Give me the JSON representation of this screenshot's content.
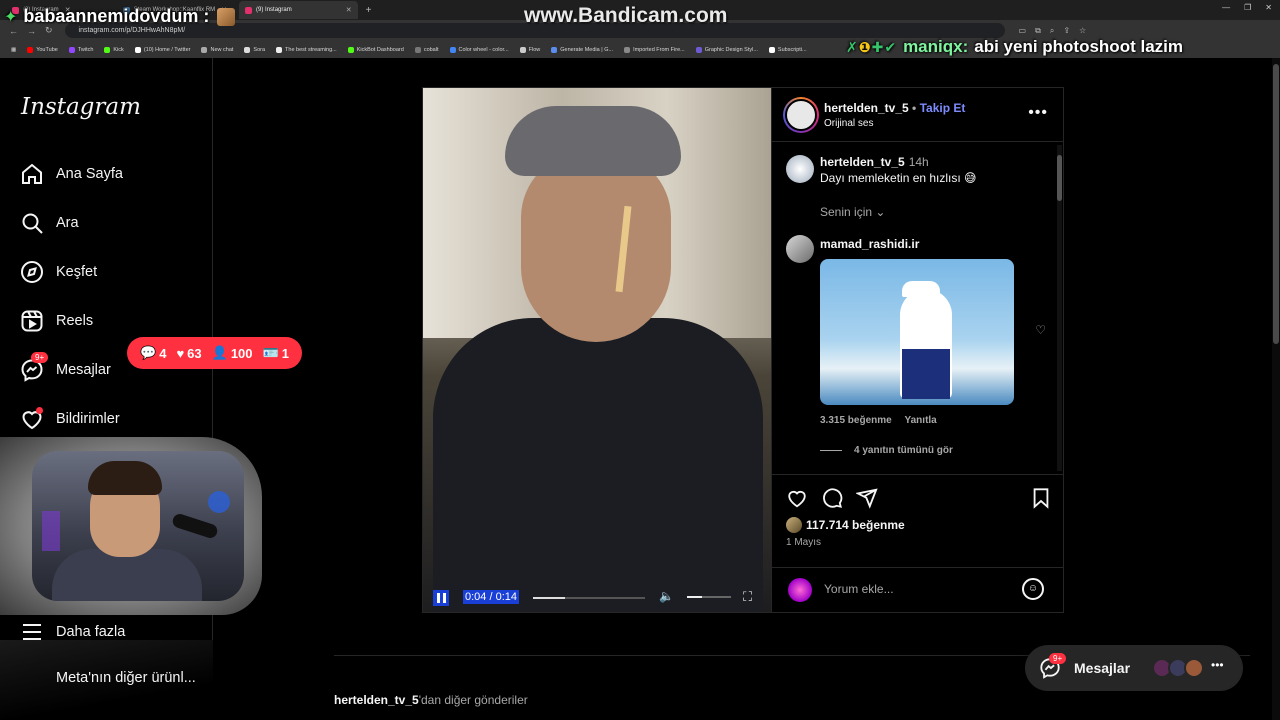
{
  "browser": {
    "tabs": [
      {
        "label": "(9) Instagram",
        "color": "#e1306c",
        "active": false
      },
      {
        "label": "Steam Workshop::Kaanflix RM",
        "color": "#1b2838",
        "active": false
      },
      {
        "label": "(9) Instagram",
        "color": "#e1306c",
        "active": true
      }
    ],
    "url": "instagram.com/p/DJHHwAhN8pM/",
    "bookmarks": [
      "YouTube",
      "Twitch",
      "Kick",
      "(10) Home / Twitter",
      "New chat",
      "Sora",
      "The best streaming...",
      "KickBot Dashboard",
      "cobalt",
      "Color wheel - color...",
      "Flow",
      "Generate Media | G...",
      "Imported From Fire...",
      "Graphic Design Styl...",
      "Subscripti..."
    ]
  },
  "overlay": {
    "watermark": "www.Bandicam.com",
    "streamer_title": "babaannemidovdum :",
    "chat_user": "maniqx:",
    "chat_text": "abi yeni photoshoot lazim"
  },
  "sidebar": {
    "logo": "Instagram",
    "items": [
      {
        "label": "Ana Sayfa",
        "icon": "home-icon"
      },
      {
        "label": "Ara",
        "icon": "search-icon"
      },
      {
        "label": "Keşfet",
        "icon": "compass-icon"
      },
      {
        "label": "Reels",
        "icon": "reels-icon"
      },
      {
        "label": "Mesajlar",
        "icon": "messenger-icon",
        "badge": "9+"
      },
      {
        "label": "Bildirimler",
        "icon": "heart-icon"
      }
    ],
    "more": "Daha fazla",
    "meta": "Meta'nın diğer ürünl..."
  },
  "notifications_pill": {
    "comments": "4",
    "likes": "63",
    "follows": "100",
    "requests": "1"
  },
  "post": {
    "username": "hertelden_tv_5",
    "separator": "•",
    "follow": "Takip Et",
    "audio": "Orijinal ses",
    "caption_user": "hertelden_tv_5",
    "caption_time": "14h",
    "caption": "Dayı memleketin en hızlısı 😅",
    "sort_label": "Senin için",
    "comment_user": "mamad_rashidi.ir",
    "comment_likes": "3.315 beğenme",
    "comment_reply": "Yanıtla",
    "view_replies": "4 yanıtın tümünü gör",
    "likes": "117.714 beğenme",
    "date": "1 Mayıs",
    "add_comment_placeholder": "Yorum ekle..."
  },
  "video": {
    "time": "0:04 / 0:14",
    "progress": 0.29,
    "volume": 0.35
  },
  "footer": {
    "more_from_user": "hertelden_tv_5",
    "more_from_suffix": "'dan diğer gönderiler"
  },
  "messages_pill": {
    "label": "Mesajlar",
    "badge": "9+"
  },
  "colors": {
    "accent_blue": "#7d8cff",
    "badge_red": "#ff3040",
    "background": "#000000"
  }
}
